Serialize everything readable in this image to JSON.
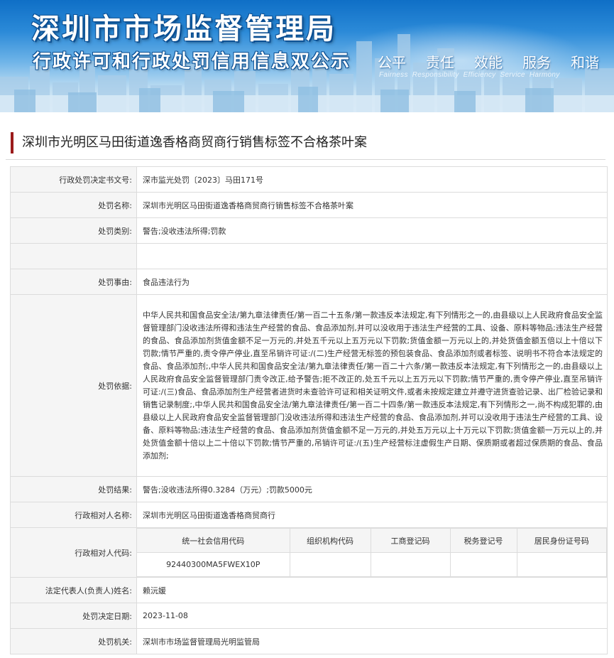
{
  "banner": {
    "title": "深圳市市场监督管理局",
    "subtitle": "行政许可和行政处罚信用信息双公示",
    "slogan_cn": [
      "公平",
      "责任",
      "效能",
      "服务",
      "和谐"
    ],
    "slogan_en": [
      "Fairness",
      "Responsibility",
      "Efficiency",
      "Service",
      "Harmony"
    ]
  },
  "case_title": "深圳市光明区马田街道逸香格商贸商行销售标签不合格茶叶案",
  "fields": {
    "decision_no": {
      "label": "行政处罚决定书文号:",
      "value": "深市监光处罚〔2023〕马田171号"
    },
    "name": {
      "label": "处罚名称:",
      "value": "深圳市光明区马田街道逸香格商贸商行销售标签不合格茶叶案"
    },
    "category": {
      "label": "处罚类别:",
      "value": "警告;没收违法所得;罚款"
    },
    "blank": {
      "label": "",
      "value": ""
    },
    "reason": {
      "label": "处罚事由:",
      "value": "食品违法行为"
    },
    "basis": {
      "label": "处罚依据:",
      "value": "中华人民共和国食品安全法/第九章法律责任/第一百二十五条/第一款违反本法规定,有下列情形之一的,由县级以上人民政府食品安全监督管理部门没收违法所得和违法生产经营的食品、食品添加剂,并可以没收用于违法生产经营的工具、设备、原料等物品;违法生产经营的食品、食品添加剂货值金额不足一万元的,并处五千元以上五万元以下罚款;货值金额一万元以上的,并处货值金额五倍以上十倍以下罚款;情节严重的,责令停产停业,直至吊销许可证:/(二)生产经营无标签的预包装食品、食品添加剂或者标签、说明书不符合本法规定的食品、食品添加剂;,中华人民共和国食品安全法/第九章法律责任/第一百二十六条/第一款违反本法规定,有下列情形之一的,由县级以上人民政府食品安全监督管理部门责令改正,给予警告;拒不改正的,处五千元以上五万元以下罚款;情节严重的,责令停产停业,直至吊销许可证:/(三)食品、食品添加剂生产经营者进货时未查验许可证和相关证明文件,或者未按规定建立并遵守进货查验记录、出厂检验记录和销售记录制度;,中华人民共和国食品安全法/第九章法律责任/第一百二十四条/第一款违反本法规定,有下列情形之一,尚不构成犯罪的,由县级以上人民政府食品安全监督管理部门没收违法所得和违法生产经营的食品、食品添加剂,并可以没收用于违法生产经营的工具、设备、原料等物品;违法生产经营的食品、食品添加剂货值金额不足一万元的,并处五万元以上十万元以下罚款;货值金额一万元以上的,并处货值金额十倍以上二十倍以下罚款;情节严重的,吊销许可证:/(五)生产经营标注虚假生产日期、保质期或者超过保质期的食品、食品添加剂;"
    },
    "result": {
      "label": "处罚结果:",
      "value": "警告;没收违法所得0.3284（万元）;罚款5000元"
    },
    "counterpart_name": {
      "label": "行政相对人名称:",
      "value": "深圳市光明区马田街道逸香格商贸商行"
    },
    "counterpart_code": {
      "label": "行政相对人代码:",
      "headers": [
        "统一社会信用代码",
        "组织机构代码",
        "工商登记码",
        "税务登记号",
        "居民身份证号码"
      ],
      "values": [
        "92440300MA5FWEX10P",
        "",
        "",
        "",
        ""
      ]
    },
    "legal_rep": {
      "label": "法定代表人(负责人)姓名:",
      "value": "赖沅媛"
    },
    "decision_date": {
      "label": "处罚决定日期:",
      "value": "2023-11-08"
    },
    "authority": {
      "label": "处罚机关:",
      "value": "深圳市市场监督管理局光明监管局"
    }
  }
}
